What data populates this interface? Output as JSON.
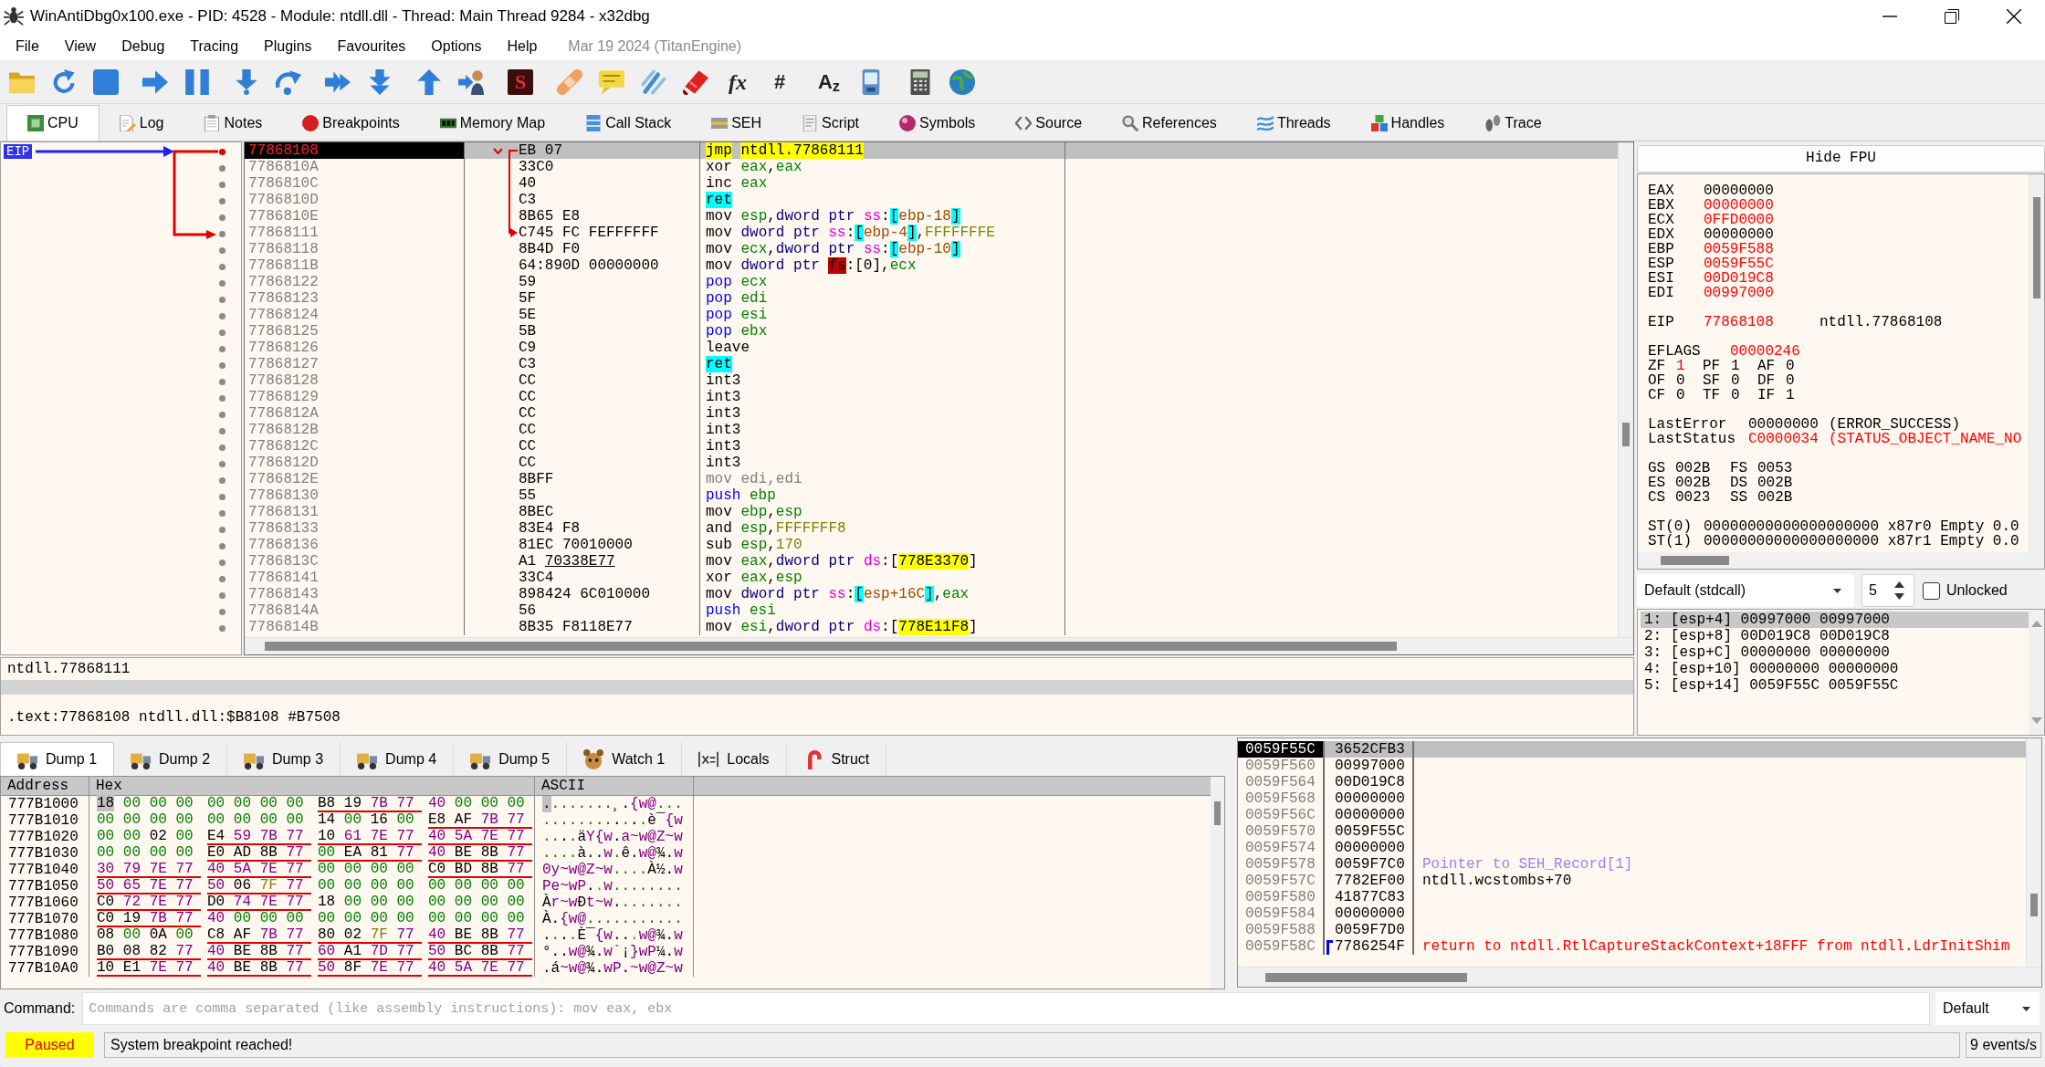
{
  "window": {
    "title": "WinAntiDbg0x100.exe - PID: 4528 - Module: ntdll.dll - Thread: Main Thread 9284 - x32dbg"
  },
  "menu": [
    "File",
    "View",
    "Debug",
    "Tracing",
    "Plugins",
    "Favourites",
    "Options",
    "Help"
  ],
  "build_info": "Mar 19 2024 (TitanEngine)",
  "toolbar_glyphs": [
    "S",
    "fx",
    "#",
    "A$_{z}$"
  ],
  "tabs": [
    {
      "label": "CPU",
      "selected": true
    },
    {
      "label": "Log",
      "selected": false
    },
    {
      "label": "Notes",
      "selected": false
    },
    {
      "label": "Breakpoints",
      "selected": false
    },
    {
      "label": "Memory Map",
      "selected": false
    },
    {
      "label": "Call Stack",
      "selected": false
    },
    {
      "label": "SEH",
      "selected": false
    },
    {
      "label": "Script",
      "selected": false
    },
    {
      "label": "Symbols",
      "selected": false
    },
    {
      "label": "Source",
      "selected": false
    },
    {
      "label": "References",
      "selected": false
    },
    {
      "label": "Threads",
      "selected": false
    },
    {
      "label": "Handles",
      "selected": false
    },
    {
      "label": "Trace",
      "selected": false
    }
  ],
  "disassembly": {
    "eip_label": "EIP",
    "rows": [
      {
        "address": "77868108",
        "bytes": "EB 07",
        "instruction": [
          {
            "text": "jmp ",
            "kind": "jump"
          },
          {
            "text": "ntdll.77868111",
            "kind": "label"
          }
        ],
        "selected": true,
        "eip": true,
        "jump_from": true,
        "jump_to": false
      },
      {
        "address": "7786810A",
        "bytes": "33C0",
        "instruction": [
          {
            "text": "xor ",
            "kind": "mnemonic"
          },
          {
            "text": "eax",
            "kind": "register"
          },
          {
            "text": ",",
            "kind": "punct"
          },
          {
            "text": "eax",
            "kind": "register"
          }
        ],
        "selected": false,
        "eip": false,
        "jump_from": false,
        "jump_to": false
      },
      {
        "address": "7786810C",
        "bytes": "40",
        "instruction": [
          {
            "text": "inc ",
            "kind": "mnemonic"
          },
          {
            "text": "eax",
            "kind": "register"
          }
        ],
        "selected": false,
        "eip": false,
        "jump_from": false,
        "jump_to": false
      },
      {
        "address": "7786810D",
        "bytes": "C3",
        "instruction": [
          {
            "text": "ret",
            "kind": "return"
          }
        ],
        "selected": false,
        "eip": false,
        "jump_from": false,
        "jump_to": false
      },
      {
        "address": "7786810E",
        "bytes": "8B65 E8",
        "instruction": [
          {
            "text": "mov ",
            "kind": "mnemonic"
          },
          {
            "text": "esp",
            "kind": "register"
          },
          {
            "text": ",",
            "kind": "punct"
          },
          {
            "text": "dword ptr ",
            "kind": "size"
          },
          {
            "text": "ss",
            "kind": "segment"
          },
          {
            "text": ":",
            "kind": "punct"
          },
          {
            "text": "[",
            "kind": "bracket"
          },
          {
            "text": "ebp-18",
            "kind": "memory"
          },
          {
            "text": "]",
            "kind": "bracket"
          }
        ],
        "selected": false,
        "eip": false,
        "jump_from": false,
        "jump_to": false
      },
      {
        "address": "77868111",
        "bytes": "C745 FC FEFFFFFF",
        "instruction": [
          {
            "text": "mov ",
            "kind": "mnemonic"
          },
          {
            "text": "dword ptr ",
            "kind": "size"
          },
          {
            "text": "ss",
            "kind": "segment"
          },
          {
            "text": ":",
            "kind": "punct"
          },
          {
            "text": "[",
            "kind": "bracket"
          },
          {
            "text": "ebp-4",
            "kind": "memory"
          },
          {
            "text": "]",
            "kind": "bracket"
          },
          {
            "text": ",",
            "kind": "punct"
          },
          {
            "text": "FFFFFFFE",
            "kind": "number"
          }
        ],
        "selected": false,
        "eip": false,
        "jump_from": false,
        "jump_to": true
      },
      {
        "address": "77868118",
        "bytes": "8B4D F0",
        "instruction": [
          {
            "text": "mov ",
            "kind": "mnemonic"
          },
          {
            "text": "ecx",
            "kind": "register"
          },
          {
            "text": ",",
            "kind": "punct"
          },
          {
            "text": "dword ptr ",
            "kind": "size"
          },
          {
            "text": "ss",
            "kind": "segment"
          },
          {
            "text": ":",
            "kind": "punct"
          },
          {
            "text": "[",
            "kind": "bracket"
          },
          {
            "text": "ebp-10",
            "kind": "memory"
          },
          {
            "text": "]",
            "kind": "bracket"
          }
        ],
        "selected": false,
        "eip": false,
        "jump_from": false,
        "jump_to": false
      },
      {
        "address": "7786811B",
        "bytes": "64:890D 00000000",
        "instruction": [
          {
            "text": "mov ",
            "kind": "mnemonic"
          },
          {
            "text": "dword ptr ",
            "kind": "size"
          },
          {
            "text": "fs",
            "kind": "segment_alert"
          },
          {
            "text": ":[0],",
            "kind": "punct"
          },
          {
            "text": "ecx",
            "kind": "register"
          }
        ],
        "selected": false,
        "eip": false,
        "jump_from": false,
        "jump_to": false
      },
      {
        "address": "77868122",
        "bytes": "59",
        "instruction": [
          {
            "text": "pop ",
            "kind": "stack"
          },
          {
            "text": "ecx",
            "kind": "register"
          }
        ],
        "selected": false,
        "eip": false,
        "jump_from": false,
        "jump_to": false
      },
      {
        "address": "77868123",
        "bytes": "5F",
        "instruction": [
          {
            "text": "pop ",
            "kind": "stack"
          },
          {
            "text": "edi",
            "kind": "register"
          }
        ],
        "selected": false,
        "eip": false,
        "jump_from": false,
        "jump_to": false
      },
      {
        "address": "77868124",
        "bytes": "5E",
        "instruction": [
          {
            "text": "pop ",
            "kind": "stack"
          },
          {
            "text": "esi",
            "kind": "register"
          }
        ],
        "selected": false,
        "eip": false,
        "jump_from": false,
        "jump_to": false
      },
      {
        "address": "77868125",
        "bytes": "5B",
        "instruction": [
          {
            "text": "pop ",
            "kind": "stack"
          },
          {
            "text": "ebx",
            "kind": "register"
          }
        ],
        "selected": false,
        "eip": false,
        "jump_from": false,
        "jump_to": false
      },
      {
        "address": "77868126",
        "bytes": "C9",
        "instruction": [
          {
            "text": "leave",
            "kind": "mnemonic"
          }
        ],
        "selected": false,
        "eip": false,
        "jump_from": false,
        "jump_to": false
      },
      {
        "address": "77868127",
        "bytes": "C3",
        "instruction": [
          {
            "text": "ret",
            "kind": "return"
          }
        ],
        "selected": false,
        "eip": false,
        "jump_from": false,
        "jump_to": false
      },
      {
        "address": "77868128",
        "bytes": "CC",
        "instruction": [
          {
            "text": "int3",
            "kind": "mnemonic"
          }
        ],
        "selected": false,
        "eip": false,
        "jump_from": false,
        "jump_to": false
      },
      {
        "address": "77868129",
        "bytes": "CC",
        "instruction": [
          {
            "text": "int3",
            "kind": "mnemonic"
          }
        ],
        "selected": false,
        "eip": false,
        "jump_from": false,
        "jump_to": false
      },
      {
        "address": "7786812A",
        "bytes": "CC",
        "instruction": [
          {
            "text": "int3",
            "kind": "mnemonic"
          }
        ],
        "selected": false,
        "eip": false,
        "jump_from": false,
        "jump_to": false
      },
      {
        "address": "7786812B",
        "bytes": "CC",
        "instruction": [
          {
            "text": "int3",
            "kind": "mnemonic"
          }
        ],
        "selected": false,
        "eip": false,
        "jump_from": false,
        "jump_to": false
      },
      {
        "address": "7786812C",
        "bytes": "CC",
        "instruction": [
          {
            "text": "int3",
            "kind": "mnemonic"
          }
        ],
        "selected": false,
        "eip": false,
        "jump_from": false,
        "jump_to": false
      },
      {
        "address": "7786812D",
        "bytes": "CC",
        "instruction": [
          {
            "text": "int3",
            "kind": "mnemonic"
          }
        ],
        "selected": false,
        "eip": false,
        "jump_from": false,
        "jump_to": false
      },
      {
        "address": "7786812E",
        "bytes": "8BFF",
        "instruction": [
          {
            "text": "mov edi,edi",
            "kind": "nop"
          }
        ],
        "selected": false,
        "eip": false,
        "jump_from": false,
        "jump_to": false
      },
      {
        "address": "77868130",
        "bytes": "55",
        "instruction": [
          {
            "text": "push ",
            "kind": "stack"
          },
          {
            "text": "ebp",
            "kind": "register"
          }
        ],
        "selected": false,
        "eip": false,
        "jump_from": false,
        "jump_to": false
      },
      {
        "address": "77868131",
        "bytes": "8BEC",
        "instruction": [
          {
            "text": "mov ",
            "kind": "mnemonic"
          },
          {
            "text": "ebp",
            "kind": "register"
          },
          {
            "text": ",",
            "kind": "punct"
          },
          {
            "text": "esp",
            "kind": "register"
          }
        ],
        "selected": false,
        "eip": false,
        "jump_from": false,
        "jump_to": false
      },
      {
        "address": "77868133",
        "bytes": "83E4 F8",
        "instruction": [
          {
            "text": "and ",
            "kind": "mnemonic"
          },
          {
            "text": "esp",
            "kind": "register"
          },
          {
            "text": ",",
            "kind": "punct"
          },
          {
            "text": "FFFFFFF8",
            "kind": "number"
          }
        ],
        "selected": false,
        "eip": false,
        "jump_from": false,
        "jump_to": false
      },
      {
        "address": "77868136",
        "bytes": "81EC 70010000",
        "instruction": [
          {
            "text": "sub ",
            "kind": "mnemonic"
          },
          {
            "text": "esp",
            "kind": "register"
          },
          {
            "text": ",",
            "kind": "punct"
          },
          {
            "text": "170",
            "kind": "number"
          }
        ],
        "selected": false,
        "eip": false,
        "jump_from": false,
        "jump_to": false
      },
      {
        "address": "7786813C",
        "bytes": "A1 70338E77",
        "relocated": true,
        "instruction": [
          {
            "text": "mov ",
            "kind": "mnemonic"
          },
          {
            "text": "eax",
            "kind": "register"
          },
          {
            "text": ",",
            "kind": "punct"
          },
          {
            "text": "dword ptr ",
            "kind": "size"
          },
          {
            "text": "ds",
            "kind": "segment"
          },
          {
            "text": ":[",
            "kind": "punct"
          },
          {
            "text": "778E3370",
            "kind": "address"
          },
          {
            "text": "]",
            "kind": "punct"
          }
        ],
        "selected": false,
        "eip": false,
        "jump_from": false,
        "jump_to": false
      },
      {
        "address": "77868141",
        "bytes": "33C4",
        "instruction": [
          {
            "text": "xor ",
            "kind": "mnemonic"
          },
          {
            "text": "eax",
            "kind": "register"
          },
          {
            "text": ",",
            "kind": "punct"
          },
          {
            "text": "esp",
            "kind": "register"
          }
        ],
        "selected": false,
        "eip": false,
        "jump_from": false,
        "jump_to": false
      },
      {
        "address": "77868143",
        "bytes": "898424 6C010000",
        "instruction": [
          {
            "text": "mov ",
            "kind": "mnemonic"
          },
          {
            "text": "dword ptr ",
            "kind": "size"
          },
          {
            "text": "ss",
            "kind": "segment"
          },
          {
            "text": ":",
            "kind": "punct"
          },
          {
            "text": "[",
            "kind": "bracket"
          },
          {
            "text": "esp+16C",
            "kind": "memory"
          },
          {
            "text": "]",
            "kind": "bracket"
          },
          {
            "text": ",",
            "kind": "punct"
          },
          {
            "text": "eax",
            "kind": "register"
          }
        ],
        "selected": false,
        "eip": false,
        "jump_from": false,
        "jump_to": false
      },
      {
        "address": "7786814A",
        "bytes": "56",
        "instruction": [
          {
            "text": "push ",
            "kind": "stack"
          },
          {
            "text": "esi",
            "kind": "register"
          }
        ],
        "selected": false,
        "eip": false,
        "jump_from": false,
        "jump_to": false
      },
      {
        "address": "7786814B",
        "bytes": "8B35 F8118E77",
        "instruction": [
          {
            "text": "mov ",
            "kind": "mnemonic"
          },
          {
            "text": "esi",
            "kind": "register"
          },
          {
            "text": ",",
            "kind": "punct"
          },
          {
            "text": "dword ptr ",
            "kind": "size"
          },
          {
            "text": "ds",
            "kind": "segment"
          },
          {
            "text": ":[",
            "kind": "punct"
          },
          {
            "text": "778E11F8",
            "kind": "address"
          },
          {
            "text": "]",
            "kind": "punct"
          }
        ],
        "selected": false,
        "eip": false,
        "jump_from": false,
        "jump_to": false
      }
    ]
  },
  "info": {
    "lines": [
      "ntdll.77868111",
      ".text:77868108 ntdll.dll:$B8108 #B7508"
    ]
  },
  "registers": {
    "hide_fpu": "Hide FPU",
    "general": [
      {
        "name": "EAX",
        "value": "00000000",
        "changed": false
      },
      {
        "name": "EBX",
        "value": "00000000",
        "changed": true
      },
      {
        "name": "ECX",
        "value": "0FFD0000",
        "changed": true
      },
      {
        "name": "EDX",
        "value": "00000000",
        "changed": false
      },
      {
        "name": "EBP",
        "value": "0059F588",
        "changed": true
      },
      {
        "name": "ESP",
        "value": "0059F55C",
        "changed": true
      },
      {
        "name": "ESI",
        "value": "00D019C8",
        "changed": true
      },
      {
        "name": "EDI",
        "value": "00997000",
        "changed": true
      }
    ],
    "eip": {
      "name": "EIP",
      "value": "77868108",
      "changed": true,
      "comment": "ntdll.77868108"
    },
    "eflags": {
      "name": "EFLAGS",
      "value": "00000246",
      "changed": true
    },
    "flags": [
      [
        {
          "name": "ZF",
          "value": "1",
          "changed": true
        },
        {
          "name": "PF",
          "value": "1",
          "changed": false
        },
        {
          "name": "AF",
          "value": "0",
          "changed": false
        }
      ],
      [
        {
          "name": "OF",
          "value": "0",
          "changed": false
        },
        {
          "name": "SF",
          "value": "0",
          "changed": false
        },
        {
          "name": "DF",
          "value": "0",
          "changed": false
        }
      ],
      [
        {
          "name": "CF",
          "value": "0",
          "changed": false
        },
        {
          "name": "TF",
          "value": "0",
          "changed": false
        },
        {
          "name": "IF",
          "value": "1",
          "changed": false
        }
      ]
    ],
    "last_error": {
      "name": "LastError",
      "value": "00000000",
      "changed": false,
      "comment": "(ERROR_SUCCESS)"
    },
    "last_status": {
      "name": "LastStatus",
      "value": "C0000034",
      "changed": true,
      "comment": "(STATUS_OBJECT_NAME_NO"
    },
    "segments": [
      [
        {
          "name": "GS",
          "value": "002B"
        },
        {
          "name": "FS",
          "value": "0053"
        }
      ],
      [
        {
          "name": "ES",
          "value": "002B"
        },
        {
          "name": "DS",
          "value": "002B"
        }
      ],
      [
        {
          "name": "CS",
          "value": "0023"
        },
        {
          "name": "SS",
          "value": "002B"
        }
      ]
    ],
    "fpu": [
      {
        "name": "ST(0)",
        "value": "00000000000000000000",
        "tag": "x87r0",
        "state": "Empty",
        "number": "0.0"
      },
      {
        "name": "ST(1)",
        "value": "00000000000000000000",
        "tag": "x87r1",
        "state": "Empty",
        "number": "0.0"
      }
    ]
  },
  "call_convention": {
    "convention": "Default (stdcall)",
    "count": "5",
    "unlocked": {
      "label": "Unlocked",
      "checked": false
    },
    "arguments": [
      {
        "text": "1: [esp+4] 00997000 00997000",
        "selected": true
      },
      {
        "text": "2: [esp+8] 00D019C8 00D019C8",
        "selected": false
      },
      {
        "text": "3: [esp+C] 00000000 00000000",
        "selected": false
      },
      {
        "text": "4: [esp+10] 00000000 00000000",
        "selected": false
      },
      {
        "text": "5: [esp+14] 0059F55C 0059F55C",
        "selected": false
      }
    ]
  },
  "dump_tabs": [
    {
      "label": "Dump 1",
      "selected": true
    },
    {
      "label": "Dump 2",
      "selected": false
    },
    {
      "label": "Dump 3",
      "selected": false
    },
    {
      "label": "Dump 4",
      "selected": false
    },
    {
      "label": "Dump 5",
      "selected": false
    },
    {
      "label": "Watch 1",
      "selected": false
    },
    {
      "label": "Locals",
      "selected": false
    },
    {
      "label": "Struct",
      "selected": false
    }
  ],
  "dump": {
    "columns": [
      "Address",
      "Hex",
      "ASCII"
    ],
    "rows": [
      {
        "address": "777B1000",
        "selected": true,
        "groups": [
          {
            "hex": "18 00 00 00",
            "pointer": false
          },
          {
            "hex": "00 00 00 00",
            "pointer": false
          },
          {
            "hex": "B8 19 7B 77",
            "pointer": true
          },
          {
            "hex": "40 00 00 00",
            "pointer": false
          }
        ],
        "ascii": "........¸.{w@..."
      },
      {
        "address": "777B1010",
        "selected": false,
        "groups": [
          {
            "hex": "00 00 00 00",
            "pointer": false
          },
          {
            "hex": "00 00 00 00",
            "pointer": false
          },
          {
            "hex": "14 00 16 00",
            "pointer": false
          },
          {
            "hex": "E8 AF 7B 77",
            "pointer": true
          }
        ],
        "ascii": "............è¯{w"
      },
      {
        "address": "777B1020",
        "selected": false,
        "groups": [
          {
            "hex": "00 00 02 00",
            "pointer": false
          },
          {
            "hex": "E4 59 7B 77",
            "pointer": true
          },
          {
            "hex": "10 61 7E 77",
            "pointer": true
          },
          {
            "hex": "40 5A 7E 77",
            "pointer": true
          }
        ],
        "ascii": "....äY{w.a~w@Z~w"
      },
      {
        "address": "777B1030",
        "selected": false,
        "groups": [
          {
            "hex": "00 00 00 00",
            "pointer": false
          },
          {
            "hex": "E0 AD 8B 77",
            "pointer": true
          },
          {
            "hex": "00 EA 81 77",
            "pointer": true
          },
          {
            "hex": "40 BE 8B 77",
            "pointer": true
          }
        ],
        "ascii": "....à..w.ê.w@¾.w"
      },
      {
        "address": "777B1040",
        "selected": false,
        "groups": [
          {
            "hex": "30 79 7E 77",
            "pointer": true
          },
          {
            "hex": "40 5A 7E 77",
            "pointer": true
          },
          {
            "hex": "00 00 00 00",
            "pointer": false
          },
          {
            "hex": "C0 BD 8B 77",
            "pointer": true
          }
        ],
        "ascii": "0y~w@Z~w....À½.w"
      },
      {
        "address": "777B1050",
        "selected": false,
        "groups": [
          {
            "hex": "50 65 7E 77",
            "pointer": true
          },
          {
            "hex": "50 06 7F 77",
            "pointer": true
          },
          {
            "hex": "00 00 00 00",
            "pointer": false
          },
          {
            "hex": "00 00 00 00",
            "pointer": false
          }
        ],
        "ascii": "Pe~wP..w........"
      },
      {
        "address": "777B1060",
        "selected": false,
        "groups": [
          {
            "hex": "C0 72 7E 77",
            "pointer": true
          },
          {
            "hex": "D0 74 7E 77",
            "pointer": true
          },
          {
            "hex": "18 00 00 00",
            "pointer": false
          },
          {
            "hex": "00 00 00 00",
            "pointer": false
          }
        ],
        "ascii": "Àr~wÐt~w........"
      },
      {
        "address": "777B1070",
        "selected": false,
        "groups": [
          {
            "hex": "C0 19 7B 77",
            "pointer": true
          },
          {
            "hex": "40 00 00 00",
            "pointer": false
          },
          {
            "hex": "00 00 00 00",
            "pointer": false
          },
          {
            "hex": "00 00 00 00",
            "pointer": false
          }
        ],
        "ascii": "À.{w@..........."
      },
      {
        "address": "777B1080",
        "selected": false,
        "groups": [
          {
            "hex": "08 00 0A 00",
            "pointer": false
          },
          {
            "hex": "C8 AF 7B 77",
            "pointer": true
          },
          {
            "hex": "80 02 7F 77",
            "pointer": true
          },
          {
            "hex": "40 BE 8B 77",
            "pointer": true
          }
        ],
        "ascii": "....È¯{w...w@¾.w"
      },
      {
        "address": "777B1090",
        "selected": false,
        "groups": [
          {
            "hex": "B0 08 82 77",
            "pointer": true
          },
          {
            "hex": "40 BE 8B 77",
            "pointer": true
          },
          {
            "hex": "60 A1 7D 77",
            "pointer": true
          },
          {
            "hex": "50 BC 8B 77",
            "pointer": true
          }
        ],
        "ascii": "°..w@¾.w`¡}wP¼.w"
      },
      {
        "address": "777B10A0",
        "selected": false,
        "groups": [
          {
            "hex": "10 E1 7E 77",
            "pointer": true
          },
          {
            "hex": "40 BE 8B 77",
            "pointer": true
          },
          {
            "hex": "50 8F 7E 77",
            "pointer": true
          },
          {
            "hex": "40 5A 7E 77",
            "pointer": true
          }
        ],
        "ascii": ".á~w@¾.wP.~w@Z~w"
      }
    ]
  },
  "stack": {
    "rows": [
      {
        "address": "0059F55C",
        "value": "3652CFB3",
        "selected": true,
        "frame_start": false
      },
      {
        "address": "0059F560",
        "value": "00997000",
        "selected": false,
        "frame_start": false
      },
      {
        "address": "0059F564",
        "value": "00D019C8",
        "selected": false,
        "frame_start": false
      },
      {
        "address": "0059F568",
        "value": "00000000",
        "selected": false,
        "frame_start": false
      },
      {
        "address": "0059F56C",
        "value": "00000000",
        "selected": false,
        "frame_start": false
      },
      {
        "address": "0059F570",
        "value": "0059F55C",
        "selected": false,
        "frame_start": false
      },
      {
        "address": "0059F574",
        "value": "00000000",
        "selected": false,
        "frame_start": false
      },
      {
        "address": "0059F578",
        "value": "0059F7C0",
        "comment": {
          "text": "Pointer to SEH_Record[1]",
          "kind": "pointer"
        },
        "selected": false,
        "frame_start": false
      },
      {
        "address": "0059F57C",
        "value": "7782EF00",
        "comment": {
          "text": "ntdll.wcstombs+70",
          "kind": "symbol"
        },
        "selected": false,
        "frame_start": false
      },
      {
        "address": "0059F580",
        "value": "41877C83",
        "selected": false,
        "frame_start": false
      },
      {
        "address": "0059F584",
        "value": "00000000",
        "selected": false,
        "frame_start": false
      },
      {
        "address": "0059F588",
        "value": "0059F7D0",
        "selected": false,
        "frame_start": false
      },
      {
        "address": "0059F58C",
        "value": "7786254F",
        "comment": {
          "text": "return to ntdll.RtlCaptureStackContext+18FFF from ntdll.LdrInitShim",
          "kind": "return"
        },
        "selected": false,
        "frame_start": true
      }
    ]
  },
  "command": {
    "label": "Command:",
    "placeholder": "Commands are comma separated (like assembly instructions): mov eax, ebx",
    "engine": "Default"
  },
  "status_bar": {
    "state": "Paused",
    "message": "System breakpoint reached!",
    "events": "9 events/s"
  }
}
